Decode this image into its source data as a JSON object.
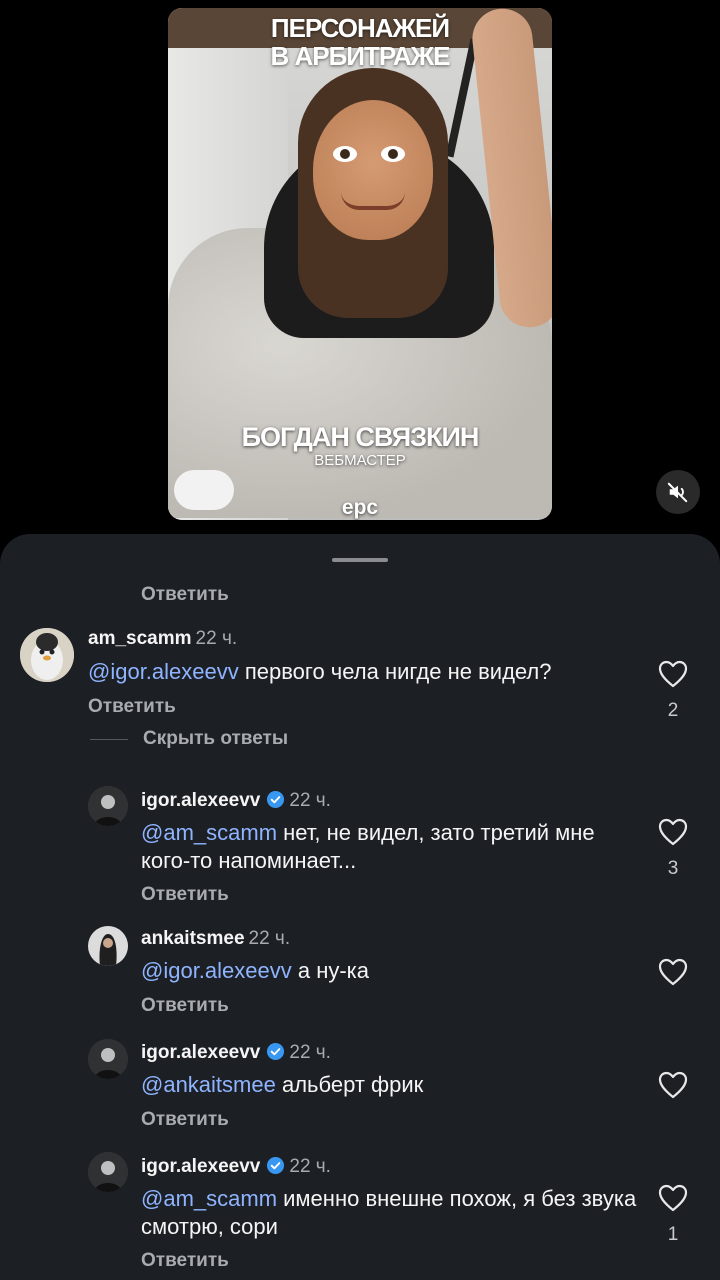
{
  "video": {
    "headline": "ПЕРСОНАЖЕЙ\nВ АРБИТРАЖЕ",
    "person_name": "БОГДАН СВЯЗКИН",
    "person_role": "ВЕБМАСТЕР",
    "brand": "epc",
    "mute_icon": "speaker-muted-icon"
  },
  "labels": {
    "reply": "Ответить",
    "hide_replies": "Скрыть ответы"
  },
  "comments": [
    {
      "user": "am_scamm",
      "time": "22 ч.",
      "mention": "@igor.alexeevv",
      "text": " первого чела нигде не видел?",
      "likes": "2",
      "verified": false
    },
    {
      "user": "igor.alexeevv",
      "time": "22 ч.",
      "mention": "@am_scamm",
      "text": " нет, не видел, зато третий мне кого-то напоминает...",
      "likes": "3",
      "verified": true
    },
    {
      "user": "ankaitsmee",
      "time": "22 ч.",
      "mention": "@igor.alexeevv",
      "text": " а ну-ка",
      "likes": "",
      "verified": false
    },
    {
      "user": "igor.alexeevv",
      "time": "22 ч.",
      "mention": "@ankaitsmee",
      "text": " альберт фрик",
      "likes": "",
      "verified": true
    },
    {
      "user": "igor.alexeevv",
      "time": "22 ч.",
      "mention": "@am_scamm",
      "text": " именно внешне похож, я без звука смотрю, сори",
      "likes": "1",
      "verified": true
    }
  ],
  "colors": {
    "sheet_bg": "#1c1f24",
    "mention": "#8fb4ff",
    "verified": "#3897f0"
  }
}
